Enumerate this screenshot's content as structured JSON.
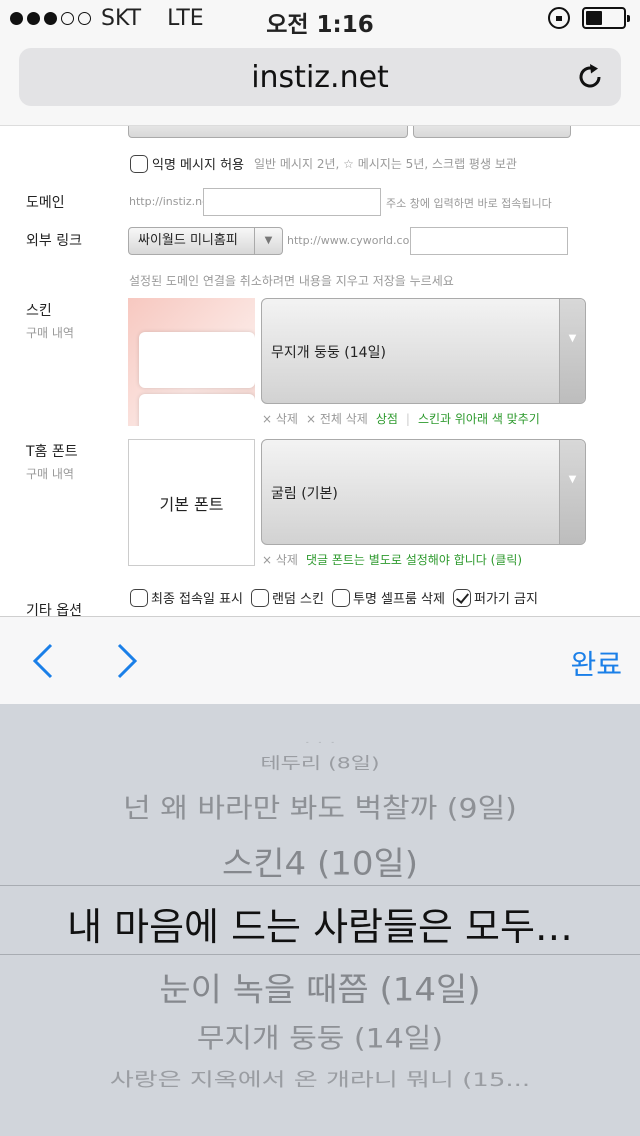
{
  "status_bar": {
    "carrier": "SKT",
    "network": "LTE",
    "time": "오전 1:16",
    "signal_bars": 3,
    "battery_level": 0.45
  },
  "browser": {
    "url": "instiz.net",
    "reload_icon": "reload-icon"
  },
  "form": {
    "anon_memo_label": "익명 메시지 허용",
    "anon_memo_note": "일반 메시지 2년, ☆ 메시지는 5년, 스크랩 평생 보관",
    "domain_label": "도메인",
    "domain_prefix": "http://instiz.net/",
    "domain_value": "",
    "domain_note": "주소 창에 입력하면 바로 접속됩니다",
    "external_link_label": "외부 링크",
    "external_link_select": "싸이월드 미니홈피",
    "external_link_prefix": "http://www.cyworld.com/",
    "external_link_value": "",
    "link_note": "설정된 도메인 연결을 취소하려면 내용을 지우고 저장을 누르세요",
    "skin_label": "스킨",
    "skin_sub": "구매 내역",
    "skin_select": "무지개 둥둥 (14일)",
    "skin_delete": "× 삭제",
    "skin_delete_all": "× 전체 삭제",
    "skin_shop": "상점",
    "skin_separator": "|",
    "skin_match_color": "스킨과 위아래 색 맞추기",
    "font_label": "T홈 폰트",
    "font_sub": "구매 내역",
    "font_preview": "기본 폰트",
    "font_select": "굴림 (기본)",
    "font_delete": "× 삭제",
    "font_note": "댓글 폰트는 별도로 설정해야 합니다 (클릭)",
    "etc_label": "기타 옵션",
    "options": [
      {
        "label": "최종 접속일 표시",
        "checked": false
      },
      {
        "label": "랜덤 스킨",
        "checked": false
      },
      {
        "label": "투명 셀프룸 삭제",
        "checked": false
      },
      {
        "label": "퍼가기 금지",
        "checked": true
      }
    ]
  },
  "toolbar": {
    "prev_icon": "chevron-left-icon",
    "next_icon": "chevron-right-icon",
    "done_label": "완료"
  },
  "picker": {
    "items": [
      "테두리 (8일)",
      "넌 왜 바라만 봐도 벅찰까 (9일)",
      "스킨4 (10일)",
      "내 마음에 드는 사람들은 모두…",
      "눈이 녹을 때쯤 (14일)",
      "무지개 둥둥 (14일)",
      "사랑은 지옥에서 온 개라니 뭐니 (15..."
    ],
    "selected_index": 3
  }
}
